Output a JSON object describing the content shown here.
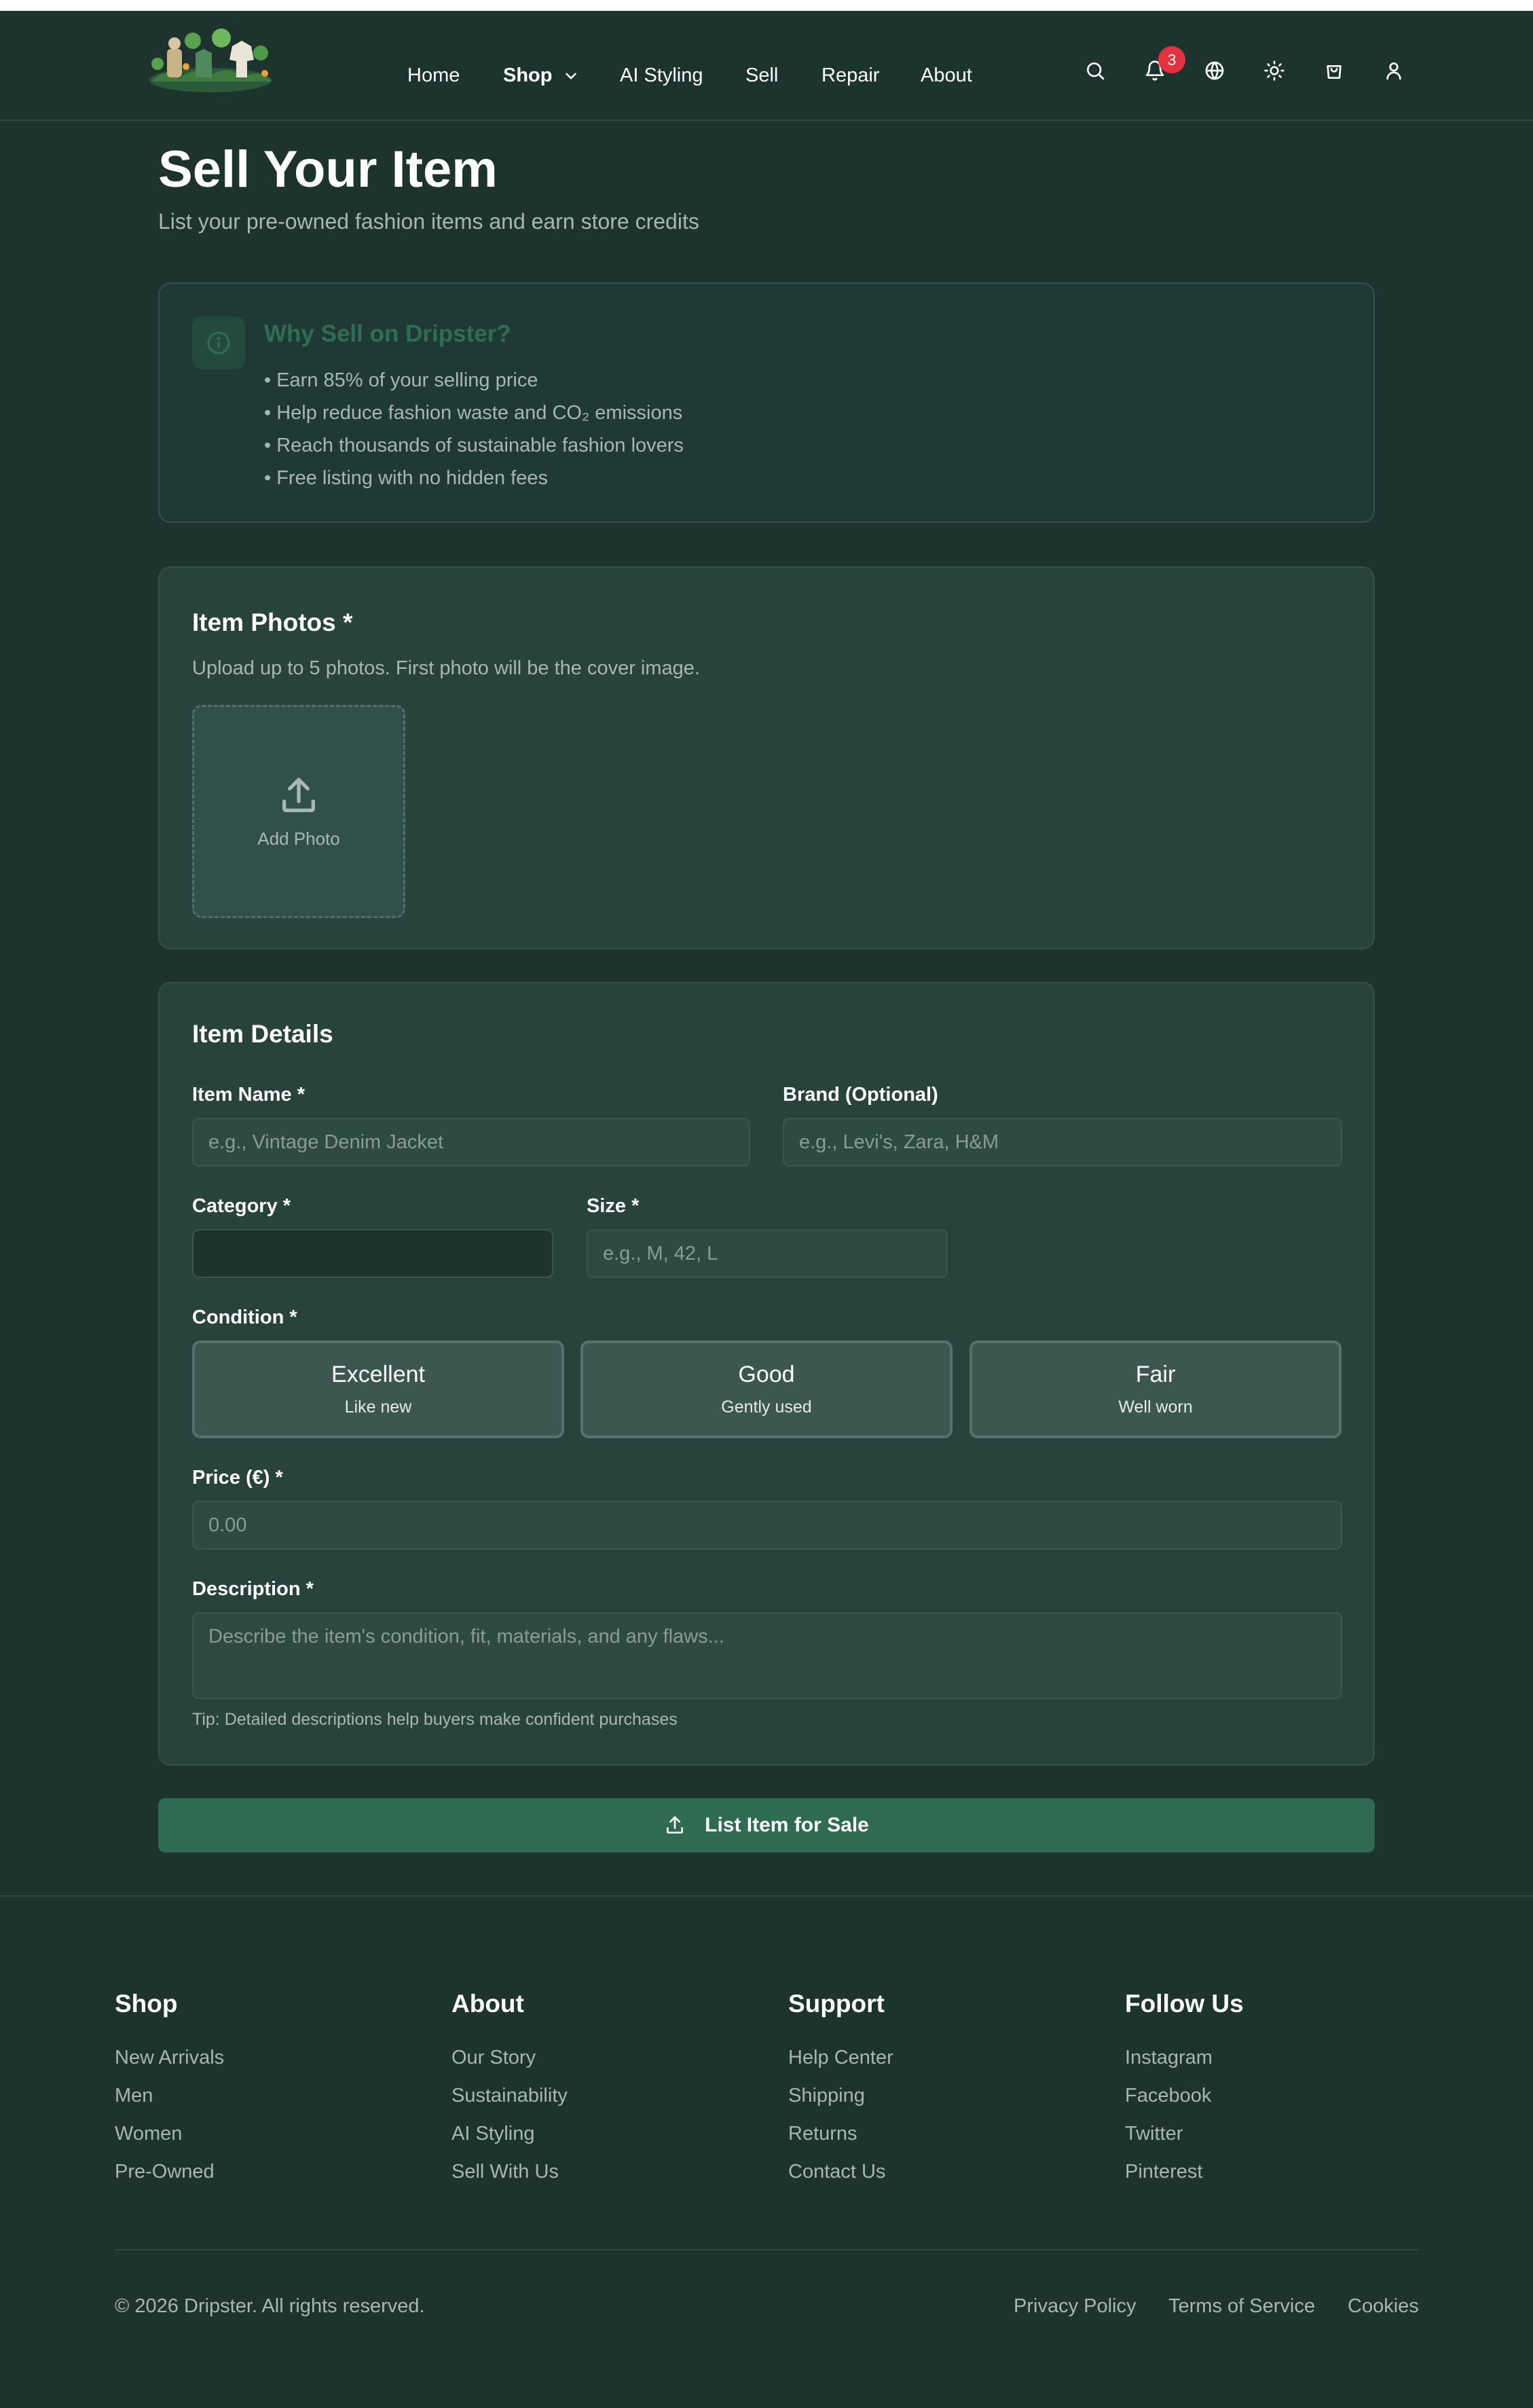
{
  "header": {
    "nav": [
      {
        "label": "Home"
      },
      {
        "label": "Shop"
      },
      {
        "label": "AI Styling"
      },
      {
        "label": "Sell"
      },
      {
        "label": "Repair"
      },
      {
        "label": "About"
      }
    ],
    "notification_count": "3",
    "icons": [
      "search-icon",
      "bell-icon",
      "globe-icon",
      "sun-icon",
      "shopping-bag-icon",
      "user-icon"
    ]
  },
  "page": {
    "title": "Sell Your Item",
    "subtitle": "List your pre-owned fashion items and earn store credits"
  },
  "why": {
    "title": "Why Sell on Dripster?",
    "items": [
      "• Earn 85% of your selling price",
      "• Help reduce fashion waste and CO₂ emissions",
      "• Reach thousands of sustainable fashion lovers",
      "• Free listing with no hidden fees"
    ]
  },
  "photos": {
    "title": "Item Photos *",
    "hint": "Upload up to 5 photos. First photo will be the cover image.",
    "add_label": "Add Photo"
  },
  "details": {
    "title": "Item Details",
    "item_name": {
      "label": "Item Name *",
      "placeholder": "e.g., Vintage Denim Jacket",
      "value": ""
    },
    "brand": {
      "label": "Brand (Optional)",
      "placeholder": "e.g., Levi's, Zara, H&M",
      "value": ""
    },
    "category": {
      "label": "Category *",
      "value": ""
    },
    "size": {
      "label": "Size *",
      "placeholder": "e.g., M, 42, L",
      "value": ""
    },
    "condition": {
      "label": "Condition *",
      "options": [
        {
          "name": "Excellent",
          "desc": "Like new"
        },
        {
          "name": "Good",
          "desc": "Gently used"
        },
        {
          "name": "Fair",
          "desc": "Well worn"
        }
      ]
    },
    "price": {
      "label": "Price (€) *",
      "placeholder": "0.00",
      "value": ""
    },
    "description": {
      "label": "Description *",
      "placeholder": "Describe the item's condition, fit, materials, and any flaws...",
      "value": ""
    },
    "tip": "Tip: Detailed descriptions help buyers make confident purchases"
  },
  "submit_label": "List Item for Sale",
  "footer": {
    "columns": [
      {
        "heading": "Shop",
        "links": [
          "New Arrivals",
          "Men",
          "Women",
          "Pre-Owned"
        ]
      },
      {
        "heading": "About",
        "links": [
          "Our Story",
          "Sustainability",
          "AI Styling",
          "Sell With Us"
        ]
      },
      {
        "heading": "Support",
        "links": [
          "Help Center",
          "Shipping",
          "Returns",
          "Contact Us"
        ]
      },
      {
        "heading": "Follow Us",
        "links": [
          "Instagram",
          "Facebook",
          "Twitter",
          "Pinterest"
        ]
      }
    ],
    "copyright": "© 2026 Dripster. All rights reserved.",
    "legal": [
      "Privacy Policy",
      "Terms of Service",
      "Cookies"
    ]
  },
  "colors": {
    "background": "#1c332e",
    "panel": "#27433c",
    "accent": "#2f6b52",
    "badge": "#e5323f",
    "muted_text": "#a8b7b3"
  }
}
